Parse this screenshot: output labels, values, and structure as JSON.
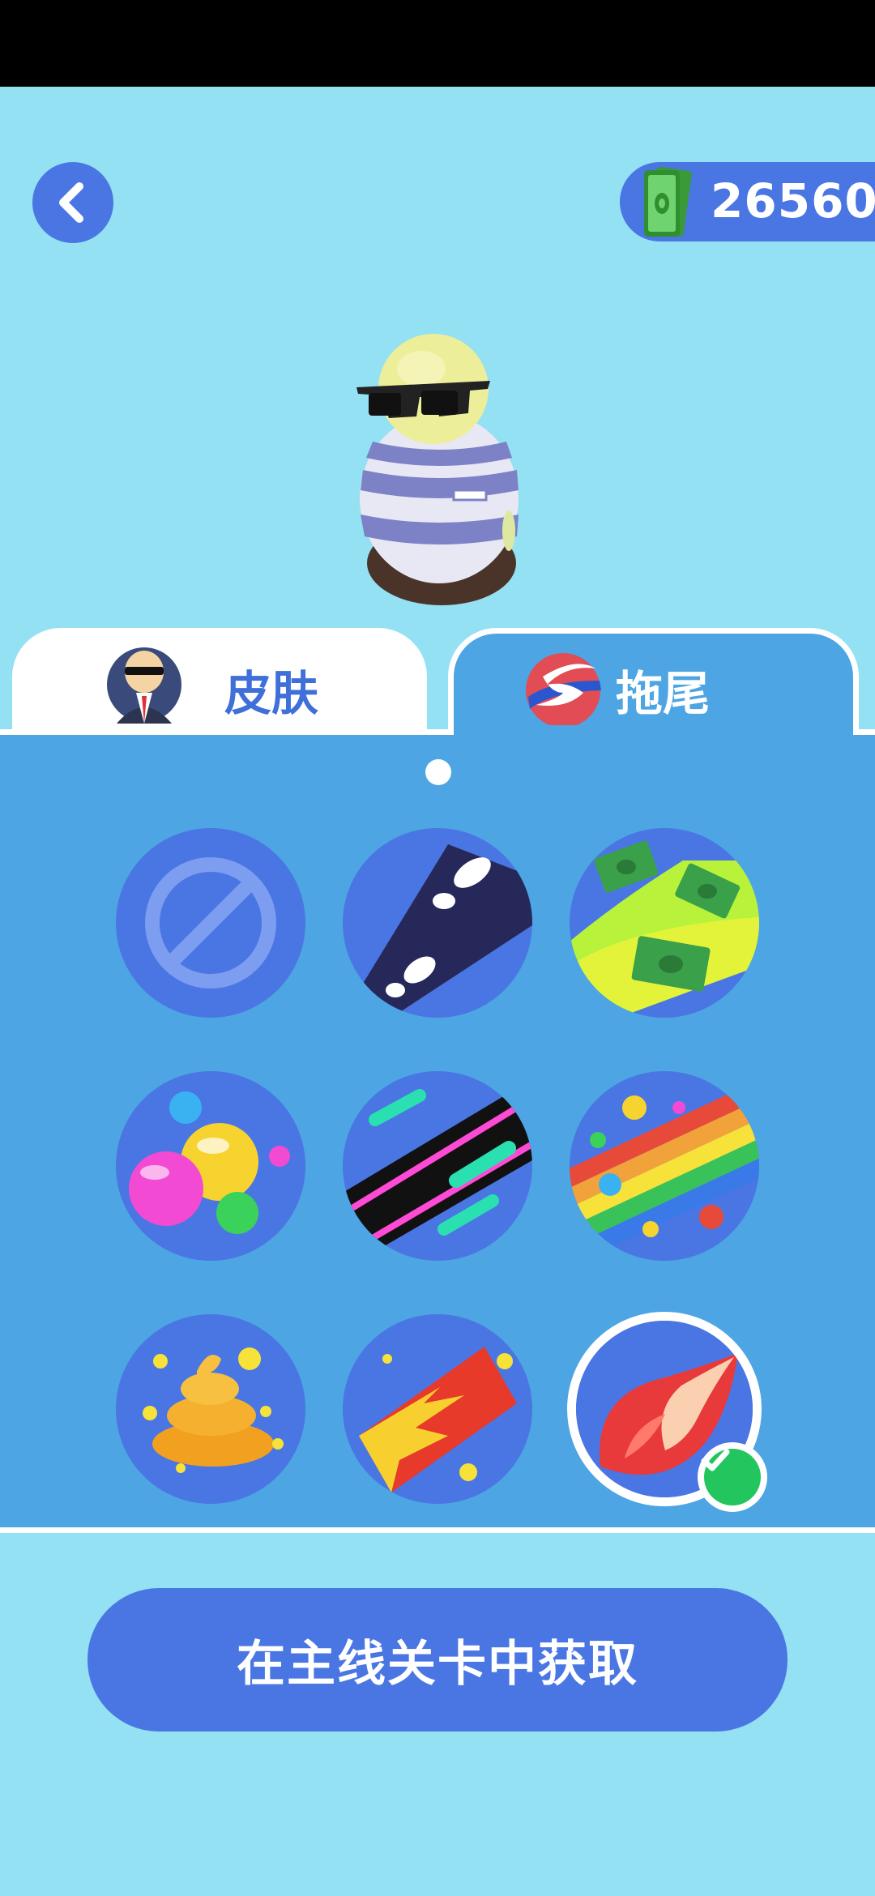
{
  "header": {
    "currency_amount": "26560",
    "currency_icon": "cash-icon",
    "back_icon": "chevron-left-icon"
  },
  "tabs": [
    {
      "label": "皮肤",
      "icon": "agent-avatar-icon",
      "selected": false
    },
    {
      "label": "拖尾",
      "icon": "trail-logo-icon",
      "selected": true
    }
  ],
  "trail_items": [
    {
      "name": "none",
      "icon": "none-icon",
      "selected": false
    },
    {
      "name": "footprints",
      "icon": "footprints-icon",
      "selected": false
    },
    {
      "name": "money",
      "icon": "money-trail-icon",
      "selected": false
    },
    {
      "name": "bubbles",
      "icon": "bubbles-icon",
      "selected": false
    },
    {
      "name": "neon",
      "icon": "neon-trail-icon",
      "selected": false
    },
    {
      "name": "rainbow",
      "icon": "rainbow-trail-icon",
      "selected": false
    },
    {
      "name": "poop",
      "icon": "poop-icon",
      "selected": false
    },
    {
      "name": "fire",
      "icon": "fire-trail-icon",
      "selected": false
    },
    {
      "name": "flame",
      "icon": "flame-trail-icon",
      "selected": true
    }
  ],
  "pagination": {
    "current_page": 1,
    "total_pages": 1
  },
  "cta": {
    "label": "在主线关卡中获取"
  },
  "colors": {
    "background": "#93e1f3",
    "accent": "#4a76e3",
    "panel": "#4da5e3",
    "selected_check": "#22c55e"
  }
}
